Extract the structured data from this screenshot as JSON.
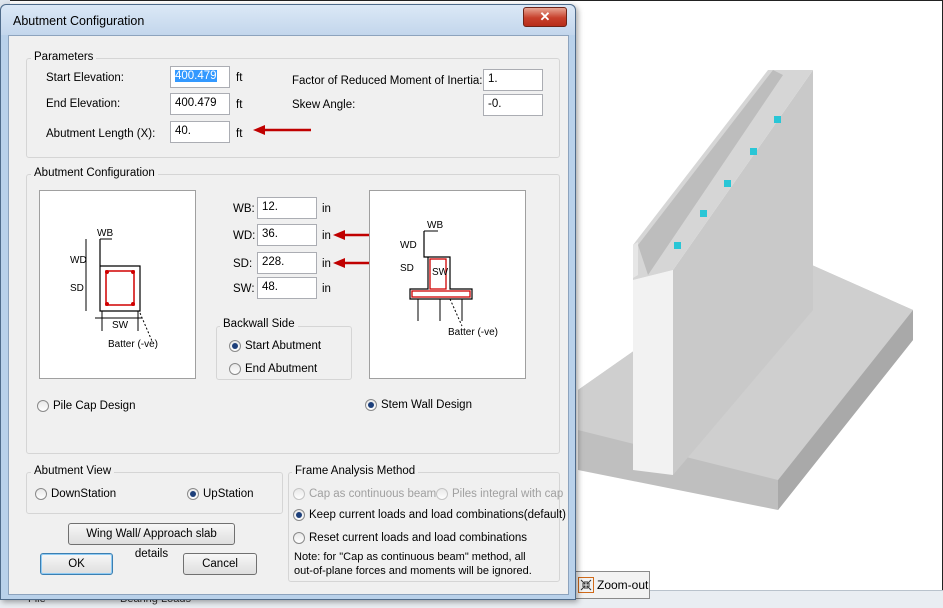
{
  "dialog": {
    "title": "Abutment Configuration",
    "close_symbol": "✕"
  },
  "parameters": {
    "group_label": "Parameters",
    "start_elevation": {
      "label": "Start Elevation:",
      "value": "400.479",
      "unit": "ft"
    },
    "end_elevation": {
      "label": "End Elevation:",
      "value": "400.479",
      "unit": "ft"
    },
    "abutment_length": {
      "label": "Abutment Length (X):",
      "value": "40.",
      "unit": "ft"
    },
    "factor_reduced_moment": {
      "label": "Factor of Reduced Moment of Inertia:",
      "value": "1."
    },
    "skew_angle": {
      "label": "Skew Angle:",
      "value": "-0."
    }
  },
  "abutment_config": {
    "group_label": "Abutment Configuration",
    "wb": {
      "label": "WB:",
      "value": "12.",
      "unit": "in"
    },
    "wd": {
      "label": "WD:",
      "value": "36.",
      "unit": "in"
    },
    "sd": {
      "label": "SD:",
      "value": "228.",
      "unit": "in"
    },
    "sw": {
      "label": "SW:",
      "value": "48.",
      "unit": "in"
    },
    "backwall_side": {
      "group_label": "Backwall Side",
      "options": [
        "Start Abutment",
        "End Abutment"
      ],
      "selected": "Start Abutment"
    },
    "design_options": [
      "Pile Cap Design",
      "Stem Wall Design"
    ],
    "selected_design": "Stem Wall Design",
    "diagram_left": {
      "wb": "WB",
      "wd": "WD",
      "sd": "SD",
      "sw": "SW",
      "batter": "Batter (-ve)"
    },
    "diagram_right": {
      "wb": "WB",
      "wd": "WD",
      "sd": "SD",
      "sw": "SW",
      "batter": "Batter (-ve)"
    }
  },
  "abutment_view": {
    "group_label": "Abutment View",
    "options": [
      "DownStation",
      "UpStation"
    ],
    "selected": "UpStation"
  },
  "frame_analysis": {
    "group_label": "Frame Analysis Method",
    "cap_continuous": "Cap as continuous beam",
    "piles_integral": "Piles integral with cap",
    "keep_current": "Keep current loads and load combinations(default)",
    "reset_current": "Reset current loads and load combinations",
    "selected": "Keep current loads and load combinations(default)",
    "note_line1": "Note: for \"Cap as continuous beam\" method, all",
    "note_line2": "out-of-plane forces and moments will be ignored."
  },
  "buttons": {
    "wing_wall": "Wing Wall/ Approach slab details",
    "ok": "OK",
    "cancel": "Cancel"
  },
  "background": {
    "zoom_out": "Zoom-out",
    "tab_file": "File",
    "tab_bearing_loads": "Bearing Loads"
  },
  "colors": {
    "annotation_arrow": "#c00000",
    "rebar": "#d00000",
    "pile_node": "#29c6d6"
  }
}
